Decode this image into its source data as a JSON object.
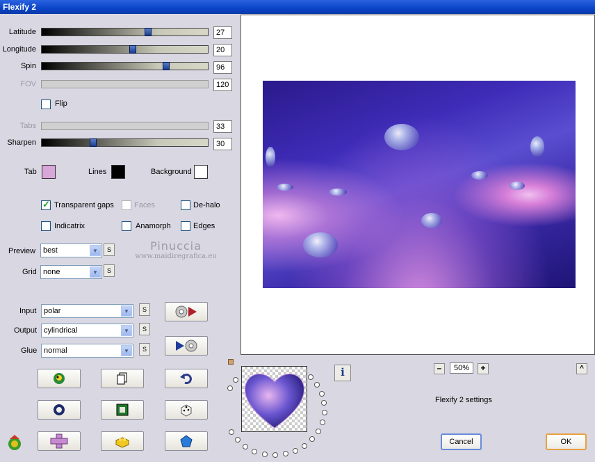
{
  "window": {
    "title": "Flexify 2"
  },
  "sliders": [
    {
      "label": "Latitude",
      "value": "27",
      "fraction": 0.64,
      "enabled": true
    },
    {
      "label": "Longitude",
      "value": "20",
      "fraction": 0.55,
      "enabled": true
    },
    {
      "label": "Spin",
      "value": "96",
      "fraction": 0.75,
      "enabled": true
    },
    {
      "label": "FOV",
      "value": "120",
      "fraction": null,
      "enabled": false
    },
    {
      "label": "Tabs",
      "value": "33",
      "fraction": null,
      "enabled": false
    },
    {
      "label": "Sharpen",
      "value": "30",
      "fraction": 0.31,
      "enabled": true
    }
  ],
  "flip": {
    "label": "Flip",
    "checked": false
  },
  "colors": {
    "tab_label": "Tab",
    "tab_color": "#d8a6d8",
    "lines_label": "Lines",
    "lines_color": "#000000",
    "background_label": "Background",
    "background_color": "#ffffff"
  },
  "options": {
    "transparent_gaps": {
      "label": "Transparent gaps",
      "checked": true
    },
    "faces": {
      "label": "Faces",
      "checked": false
    },
    "de_halo": {
      "label": "De-halo",
      "checked": false
    },
    "indicatrix": {
      "label": "Indicatrix",
      "checked": false
    },
    "anamorph": {
      "label": "Anamorph",
      "checked": false
    },
    "edges": {
      "label": "Edges",
      "checked": false
    }
  },
  "preview_select": {
    "label": "Preview",
    "value": "best",
    "s": "S"
  },
  "grid_select": {
    "label": "Grid",
    "value": "none",
    "s": "S"
  },
  "watermark": {
    "line1": "Pinuccia",
    "line2": "www.maidiregrafica.eu"
  },
  "input_select": {
    "label": "Input",
    "value": "polar",
    "s": "S"
  },
  "output_select": {
    "label": "Output",
    "value": "cylindrical",
    "s": "S"
  },
  "glue_select": {
    "label": "Glue",
    "value": "normal",
    "s": "S"
  },
  "zoom": {
    "minus": "–",
    "value": "50%",
    "plus": "+"
  },
  "info": {
    "label": "i"
  },
  "collapse": {
    "label": "^"
  },
  "settings_text": "Flexify 2 settings",
  "buttons": {
    "cancel": "Cancel",
    "ok": "OK"
  }
}
